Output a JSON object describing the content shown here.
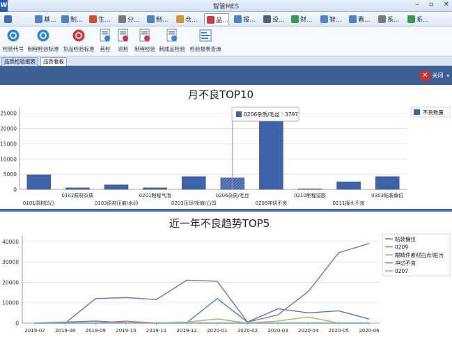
{
  "window": {
    "title": "智管MES",
    "logo_letter": "W",
    "buttons": [
      "–",
      "▫",
      "✕"
    ]
  },
  "menu": {
    "tabs": [
      {
        "label": "",
        "icon": "menu-icon",
        "color": "#3d6fb8",
        "selected": false
      },
      {
        "label": "基...",
        "icon": "base-icon",
        "color": "#4b84c8",
        "selected": false
      },
      {
        "label": "制...",
        "icon": "produce-icon",
        "color": "#4b84c8",
        "selected": false
      },
      {
        "label": "生...",
        "icon": "production-icon",
        "color": "#d05030",
        "selected": false
      },
      {
        "label": "分...",
        "icon": "split-icon",
        "color": "#7a7a7a",
        "selected": false
      },
      {
        "label": "制...",
        "icon": "monitor-icon",
        "color": "#4b84c8",
        "selected": false
      },
      {
        "label": "仓...",
        "icon": "warehouse-icon",
        "color": "#c89a30",
        "selected": false
      },
      {
        "label": "品...",
        "icon": "quality-icon",
        "color": "#d0383c",
        "selected": true
      },
      {
        "label": "报...",
        "icon": "report-icon",
        "color": "#4b84c8",
        "selected": false
      },
      {
        "label": "设...",
        "icon": "device-icon",
        "color": "#555f70",
        "selected": false
      },
      {
        "label": "财...",
        "icon": "finance-icon",
        "color": "#3a9a4a",
        "selected": false
      },
      {
        "label": "智...",
        "icon": "smart-icon",
        "color": "#4b84c8",
        "selected": false
      },
      {
        "label": "看...",
        "icon": "board-icon",
        "color": "#4b84c8",
        "selected": false
      },
      {
        "label": "系...",
        "icon": "system-icon",
        "color": "#7a7a7a",
        "selected": false
      },
      {
        "label": "系...",
        "icon": "system2-icon",
        "color": "#3a9a4a",
        "selected": false
      }
    ]
  },
  "ribbon": {
    "buttons": [
      {
        "label": "检验代号",
        "icon": "no-badge-icon",
        "color": "#2f86d6"
      },
      {
        "label": "制程检验标准",
        "icon": "shield-icon",
        "color": "#2f86d6"
      },
      {
        "label": "货品检验标准",
        "icon": "shield-red-icon",
        "color": "#d0383c"
      },
      {
        "label": "首检",
        "icon": "inspect-doc-icon",
        "color": "#2f86d6"
      },
      {
        "label": "巡检",
        "icon": "patrol-doc-icon",
        "color": "#d0383c"
      },
      {
        "label": "制程检验",
        "icon": "process-doc-icon",
        "color": "#d0383c"
      },
      {
        "label": "制成品检验",
        "icon": "product-doc-icon",
        "color": "#2f86d6"
      },
      {
        "label": "检验报表查询",
        "icon": "report-query-icon",
        "color": "#2f86d6"
      }
    ]
  },
  "doc_tabs": [
    {
      "label": "品质检验报表",
      "active": false
    },
    {
      "label": "品质看板",
      "active": true
    }
  ],
  "actions": {
    "close_label": "关闭"
  },
  "tooltip": {
    "label": "0206杂质/毛丝 : 3797"
  },
  "chart_data": [
    {
      "type": "bar",
      "title": "月不良TOP10",
      "categories": [
        "0101原材凹凸",
        "0102原材杂质",
        "0103原材压痕/水印",
        "0201制程气泡",
        "0203压印/折痕/凸凹",
        "0206杂质/毛丝",
        "0208冲切不良",
        "0210制程溢胶",
        "0211接头不良",
        "0303贴装偏位"
      ],
      "series": [
        {
          "name": "不良数量",
          "values": [
            4800,
            500,
            1500,
            500,
            4200,
            3797,
            24500,
            200,
            2500,
            4200
          ]
        }
      ],
      "highlighted_index": 5,
      "yticks": [
        0,
        5000,
        10000,
        15000,
        20000,
        25000
      ],
      "ylim": [
        0,
        27000
      ],
      "colors": {
        "bar": "#3f63a8"
      },
      "legend": "top-right",
      "grid": true
    },
    {
      "type": "line",
      "title": "近一年不良趋势TOP5",
      "x": [
        "2019-07",
        "2019-08",
        "2019-09",
        "2019-10",
        "2019-11",
        "2019-12",
        "2020-01",
        "2020-02",
        "2020-03",
        "2020-04",
        "2020-05",
        "2020-06"
      ],
      "series": [
        {
          "name": "贴装偏位",
          "color": "#4a7fb0",
          "values": [
            0,
            500,
            1000,
            200,
            0,
            200,
            12000,
            500,
            7000,
            5000,
            6000,
            2000
          ]
        },
        {
          "name": "0209",
          "color": "#cf6a6a",
          "values": [
            0,
            0,
            0,
            1000,
            0,
            0,
            0,
            0,
            0,
            0,
            0,
            0
          ]
        },
        {
          "name": "眼睛件素材白点/脏污",
          "color": "#a8b84a",
          "values": [
            0,
            0,
            0,
            0,
            0,
            500,
            2000,
            0,
            1000,
            3000,
            0,
            0
          ]
        },
        {
          "name": "冲切不良",
          "color": "#8a6aae",
          "values": [
            0,
            0,
            12000,
            12500,
            11500,
            21000,
            20500,
            500,
            4000,
            15500,
            34500,
            39000
          ]
        },
        {
          "name": "0207",
          "color": "#6ab8c8",
          "values": [
            0,
            0,
            0,
            0,
            0,
            0,
            0,
            0,
            0,
            0,
            0,
            0
          ]
        }
      ],
      "yticks": [
        0,
        10000,
        20000,
        30000,
        40000
      ],
      "ylim": [
        0,
        43000
      ],
      "legend": "top-right",
      "grid": true
    }
  ]
}
